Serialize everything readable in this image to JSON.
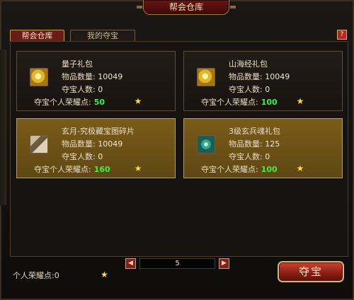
{
  "window": {
    "title": "帮会仓库"
  },
  "tabs": {
    "guild_warehouse": "帮会仓库",
    "my_treasure": "我的夺宝"
  },
  "help": {
    "label": "?"
  },
  "items": [
    {
      "name": "量子礼包",
      "quantity_label": "物品数量:",
      "quantity_value": "10049",
      "seizers_label": "夺宝人数:",
      "seizers_value": "0",
      "honor_label": "夺宝个人荣耀点:",
      "honor_value": "50",
      "icon": "pouch-icon",
      "selected": false
    },
    {
      "name": "山海经礼包",
      "quantity_label": "物品数量:",
      "quantity_value": "10049",
      "seizers_label": "夺宝人数:",
      "seizers_value": "0",
      "honor_label": "夺宝个人荣耀点:",
      "honor_value": "100",
      "icon": "pouch-icon",
      "selected": false
    },
    {
      "name": "玄月-究极藏宝图碎片",
      "quantity_label": "物品数量:",
      "quantity_value": "10049",
      "seizers_label": "夺宝人数:",
      "seizers_value": "0",
      "honor_label": "夺宝个人荣耀点:",
      "honor_value": "160",
      "icon": "map-fragment-icon",
      "selected": true
    },
    {
      "name": "3级玄兵魂礼包",
      "quantity_label": "物品数量:",
      "quantity_value": "125",
      "seizers_label": "夺宝人数:",
      "seizers_value": "0",
      "honor_label": "夺宝个人荣耀点:",
      "honor_value": "100",
      "icon": "soul-orb-icon",
      "selected": true
    }
  ],
  "pager": {
    "prev_label": "◀",
    "next_label": "▶",
    "page": "5"
  },
  "footer": {
    "personal_honor_label": "个人荣耀点:0",
    "seize_button": "夺宝"
  },
  "colors": {
    "selected_card": "#6b4f15",
    "accent_red": "#8a1d12",
    "honor_green": "#3ff04a",
    "star_gold": "#ffd64b"
  }
}
